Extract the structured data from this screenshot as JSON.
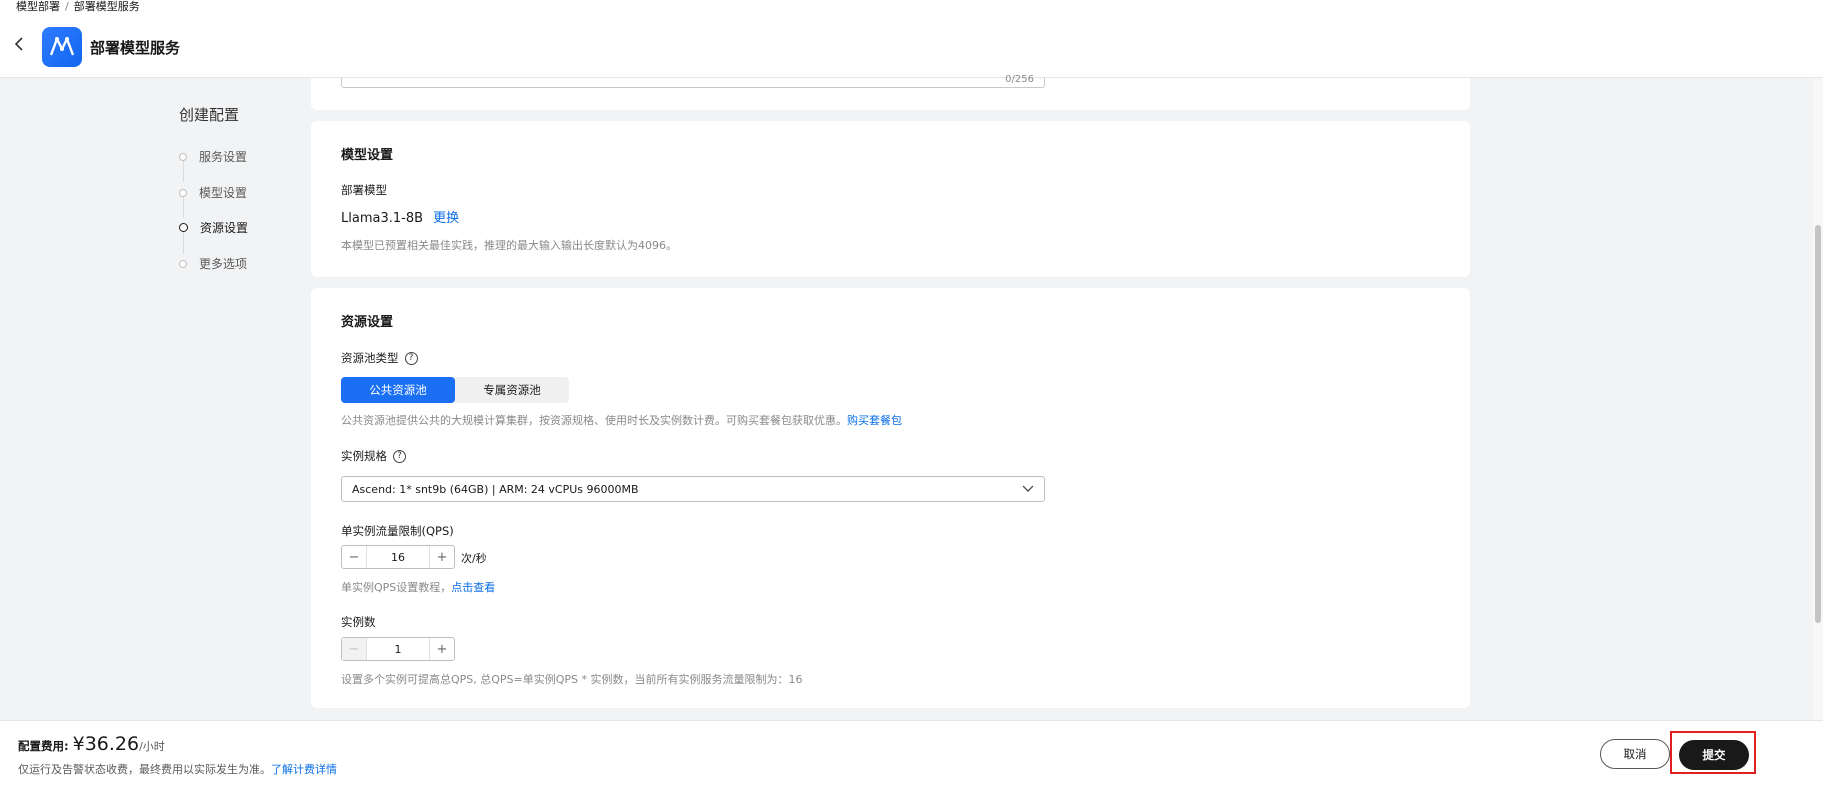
{
  "breadcrumb": {
    "parent": "模型部署",
    "current": "部署模型服务"
  },
  "header": {
    "title": "部署模型服务",
    "back_icon": "chevron-left-icon",
    "app_icon": "model-arts-logo-icon",
    "accent": "#1a6ff5"
  },
  "steps": {
    "title": "创建配置",
    "items": [
      {
        "label": "服务设置"
      },
      {
        "label": "模型设置"
      },
      {
        "label": "资源设置"
      },
      {
        "label": "更多选项"
      }
    ]
  },
  "service_card": {
    "char_count": "0/256"
  },
  "model_card": {
    "title": "模型设置",
    "deploy_label": "部署模型",
    "model_name": "Llama3.1-8B",
    "change_link": "更换",
    "note": "本模型已预置相关最佳实践，推理的最大输入输出长度默认为4096。"
  },
  "resource_card": {
    "title": "资源设置",
    "pool_type_label": "资源池类型",
    "pool_options": [
      "公共资源池",
      "专属资源池"
    ],
    "pool_note": "公共资源池提供公共的大规模计算集群，按资源规格、使用时长及实例数计费。可购买套餐包获取优惠。",
    "pool_note_link": "购买套餐包",
    "spec_label": "实例规格",
    "spec_value": "Ascend: 1* snt9b (64GB) | ARM: 24 vCPUs 96000MB",
    "qps_label": "单实例流量限制(QPS)",
    "qps_value": "16",
    "qps_unit": "次/秒",
    "qps_note": "单实例QPS设置教程，",
    "qps_note_link": "点击查看",
    "count_label": "实例数",
    "count_value": "1",
    "count_note": "设置多个实例可提高总QPS, 总QPS=单实例QPS * 实例数，当前所有实例服务流量限制为：16"
  },
  "footer": {
    "fee_label": "配置费用:",
    "fee_value": "¥36.26",
    "fee_unit": "/小时",
    "fee_note": "仅运行及告警状态收费，最终费用以实际发生为准。",
    "fee_link": "了解计费详情",
    "cancel": "取消",
    "submit": "提交"
  }
}
